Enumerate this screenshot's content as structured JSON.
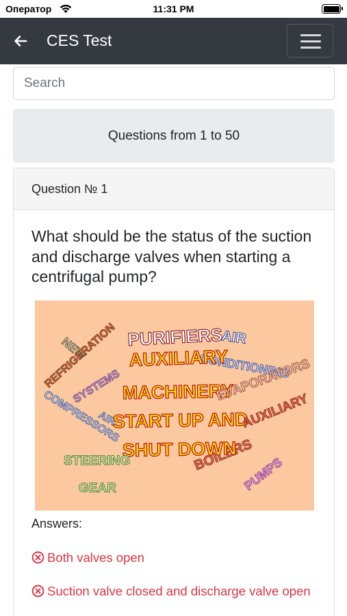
{
  "status_bar": {
    "carrier": "Оператор",
    "time": "11:31 PM"
  },
  "navbar": {
    "title": "CES Test"
  },
  "search": {
    "placeholder": "Search"
  },
  "range_header": "Questions from 1 to 50",
  "question": {
    "number_label": "Question № 1",
    "text": "What should be the status of the suction and discharge valves when starting a centrifugal pump?",
    "image_words": {
      "w_new": "NEW",
      "w_refrigeration": "REFRIGERATION",
      "w_purifiers": "PURIFIERS",
      "w_air": "AIR",
      "w_conditioning": "CONDITIONING",
      "w_auxiliary": "AUXILIARY",
      "w_systems": "SYSTEMS",
      "w_machinery": "MACHINERY",
      "w_evaporators": "EVAPORATORS",
      "w_compressors": "COMPRESSORS",
      "w_air2": "AIR",
      "w_startup": "START UP AND",
      "w_auxiliary2": "AUXILIARY",
      "w_boilers": "BOILERS",
      "w_shutdown": "SHUT DOWN",
      "w_steering": "STEERING",
      "w_gear": "GEAR",
      "w_pumps": "PUMPS"
    },
    "answers_label": "Answers:",
    "answers": [
      "Both valves open",
      "Suction valve closed and discharge valve open"
    ]
  },
  "colors": {
    "navbar_bg": "#343a40",
    "answer_wrong": "#dc3545",
    "range_bg": "#e9ecef",
    "image_bg": "#fcc89f"
  },
  "icons": [
    "wifi-icon",
    "battery-icon",
    "back-arrow-icon",
    "menu-icon",
    "wrong-answer-icon"
  ]
}
